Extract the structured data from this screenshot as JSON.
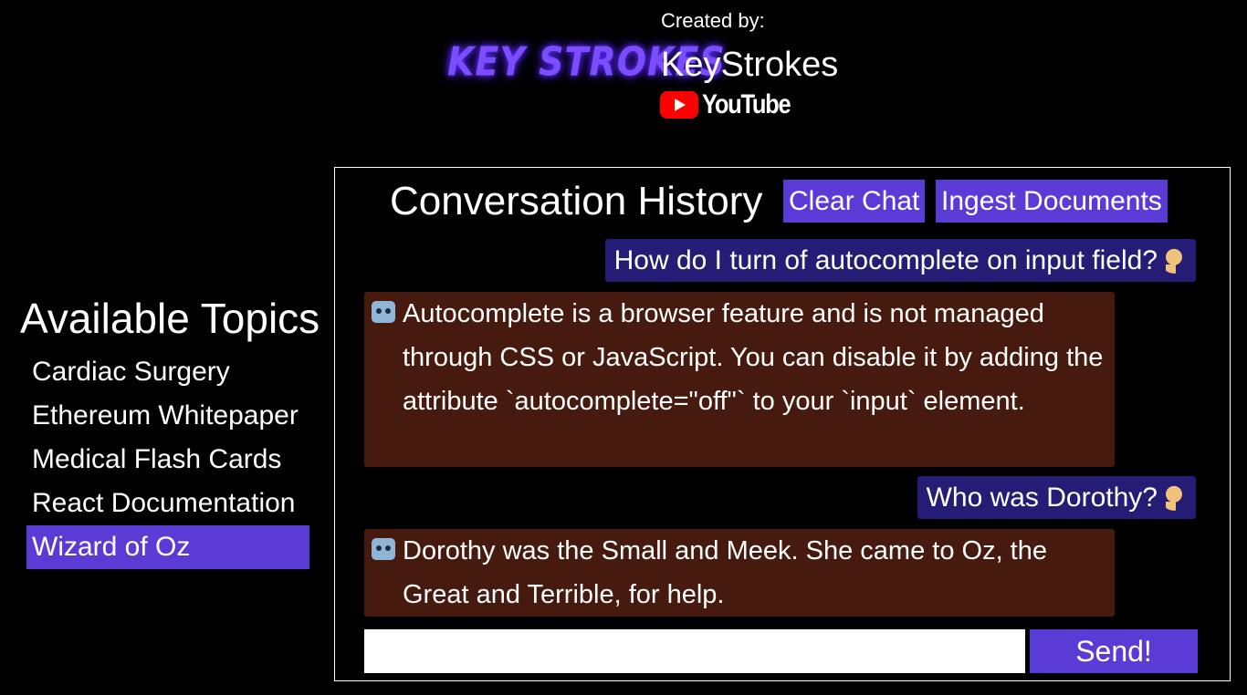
{
  "header": {
    "logo_text": "KEY STROKES",
    "created_by_label": "Created by:",
    "creator_name": "KeyStrokes",
    "youtube_label": "YouTube"
  },
  "sidebar": {
    "title": "Available Topics",
    "topics": [
      {
        "label": "Cardiac Surgery",
        "active": false
      },
      {
        "label": "Ethereum Whitepaper",
        "active": false
      },
      {
        "label": "Medical Flash Cards",
        "active": false
      },
      {
        "label": "React Documentation",
        "active": false
      },
      {
        "label": "Wizard of Oz",
        "active": true
      }
    ]
  },
  "chat": {
    "title": "Conversation History",
    "clear_label": "Clear Chat",
    "ingest_label": "Ingest Documents",
    "messages": [
      {
        "role": "user",
        "text": "How do I turn of autocomplete on input field?"
      },
      {
        "role": "bot",
        "text": "Autocomplete is a browser feature and is not managed through CSS or JavaScript. You can disable it by adding the attribute `autocomplete=\"off\"` to your `input` element."
      },
      {
        "role": "user",
        "text": "Who was Dorothy?"
      },
      {
        "role": "bot",
        "text": "Dorothy was the Small and Meek. She came to Oz, the Great and Terrible, for help."
      }
    ],
    "input_value": "",
    "send_label": "Send!"
  },
  "colors": {
    "accent": "#5a3bd6",
    "user_bubble": "#251c75",
    "bot_bubble": "#461a0e",
    "logo": "#7b4dff",
    "youtube_red": "#ff0000"
  },
  "icons": {
    "bot": "robot-icon",
    "user": "person-shrugging-icon",
    "youtube": "youtube-play-icon"
  }
}
